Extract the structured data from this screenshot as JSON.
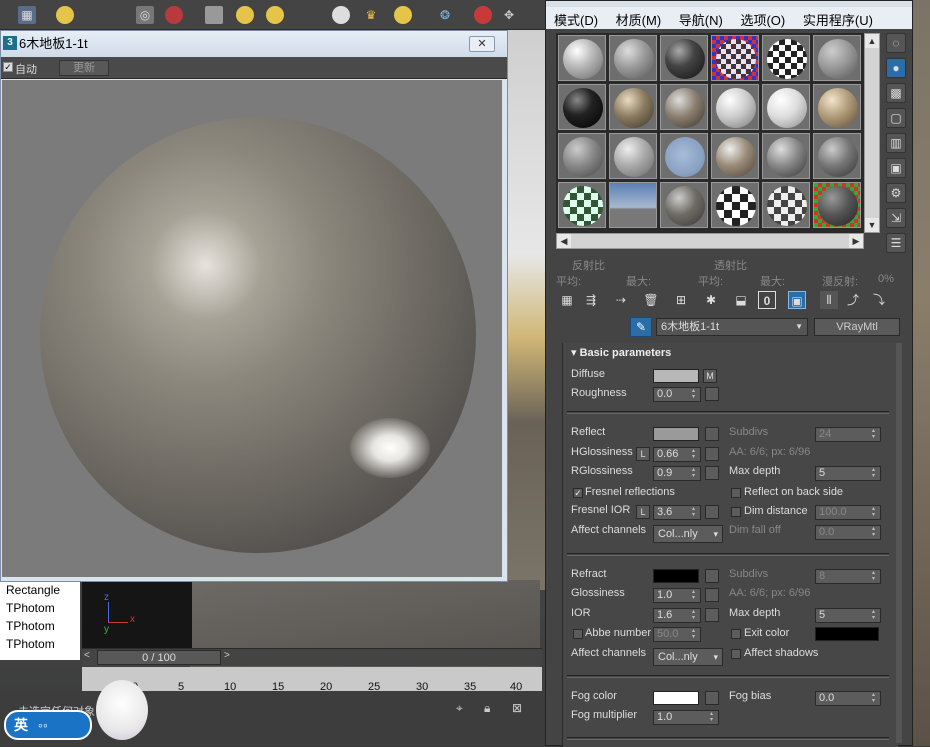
{
  "background": {
    "timeline": {
      "frame_readout": "0 / 100",
      "ticks": [
        "0",
        "5",
        "10",
        "15",
        "20",
        "25",
        "30",
        "35",
        "40"
      ]
    },
    "outliner": {
      "items": [
        "Rectangle",
        "TPhotom",
        "TPhotom",
        "TPhotom"
      ]
    },
    "status_text": "未选定任何对象",
    "ime_label": "英"
  },
  "preview_window": {
    "title": "6木地板1-1t",
    "auto_label": "自动",
    "update_label": "更新"
  },
  "material_editor": {
    "menu": [
      "模式(D)",
      "材质(M)",
      "导航(N)",
      "选项(O)",
      "实用程序(U)"
    ],
    "stats": {
      "reflect_ratio": "反射比",
      "refract_ratio": "透射比",
      "avg1": "平均:",
      "max1": "最大:",
      "avg2": "平均:",
      "max2": "最大:",
      "diffuse_reflect": "漫反射:",
      "diffuse_value": "0%"
    },
    "material_name": "6木地板1-1t",
    "material_type": "VRayMtl",
    "rollout_title": "Basic parameters",
    "diffuse": {
      "label": "Diffuse",
      "color": "#b8b8b8",
      "map_btn": "M"
    },
    "roughness": {
      "label": "Roughness",
      "value": "0.0"
    },
    "reflect": {
      "label": "Reflect",
      "color": "#9a9a9a",
      "hglossiness_label": "HGlossiness",
      "hglossiness_lock": "L",
      "hglossiness": "0.66",
      "rglossiness_label": "RGlossiness",
      "rglossiness": "0.9",
      "fresnel_label": "Fresnel reflections",
      "fresnel_checked": true,
      "fresnel_ior_label": "Fresnel IOR",
      "fresnel_ior_lock": "L",
      "fresnel_ior": "3.6",
      "affect_channels_label": "Affect channels",
      "affect_channels": "Col...nly",
      "subdivs_label": "Subdivs",
      "subdivs": "24",
      "aa_info": "AA: 6/6; px: 6/96",
      "max_depth_label": "Max depth",
      "max_depth": "5",
      "reflect_back_label": "Reflect on back side",
      "dim_distance_label": "Dim distance",
      "dim_distance": "100.0",
      "dim_falloff_label": "Dim fall off",
      "dim_falloff": "0.0"
    },
    "refract": {
      "label": "Refract",
      "color": "#000000",
      "glossiness_label": "Glossiness",
      "glossiness": "1.0",
      "ior_label": "IOR",
      "ior": "1.6",
      "abbe_label": "Abbe number",
      "abbe": "50.0",
      "affect_channels_label": "Affect channels",
      "affect_channels": "Col...nly",
      "subdivs_label": "Subdivs",
      "subdivs": "8",
      "aa_info": "AA: 6/6; px: 6/96",
      "max_depth_label": "Max depth",
      "max_depth": "5",
      "exit_color_label": "Exit color",
      "exit_color": "#000000",
      "affect_shadows_label": "Affect shadows"
    },
    "fog": {
      "color_label": "Fog color",
      "color": "#ffffff",
      "multiplier_label": "Fog multiplier",
      "multiplier": "1.0",
      "bias_label": "Fog bias",
      "bias": "0.0"
    }
  }
}
